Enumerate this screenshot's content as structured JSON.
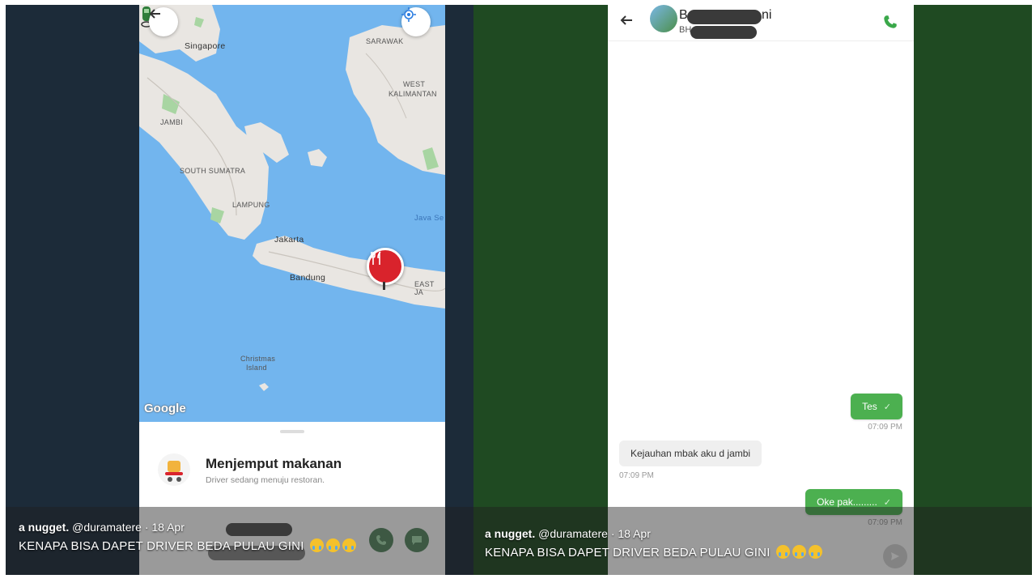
{
  "left": {
    "map": {
      "labels": {
        "singapore": "Singapore",
        "jambi": "JAMBI",
        "south_sumatra": "SOUTH SUMATRA",
        "lampung": "LAMPUNG",
        "jakarta": "Jakarta",
        "bandung": "Bandung",
        "west_kalimantan_1": "WEST",
        "west_kalimantan_2": "KALIMANTAN",
        "sarawak": "SARAWAK",
        "java_sea": "Java Se",
        "east_java": "EAST JA",
        "christmas_1": "Christmas",
        "christmas_2": "Island"
      },
      "google_logo": "Google"
    },
    "status_card": {
      "title": "Menjemput makanan",
      "subtitle": "Driver sedang menuju restoran."
    }
  },
  "right": {
    "chat": {
      "contact_name_start": "B",
      "contact_name_end": "ni",
      "contact_sub_start": "BH",
      "messages": [
        {
          "direction": "out",
          "text": "Tes",
          "time": "07:09 PM"
        },
        {
          "direction": "in",
          "text": "Kejauhan mbak aku d jambi",
          "time": "07:09 PM"
        },
        {
          "direction": "out",
          "text": "Oke pak.........",
          "time": "07:09 PM"
        }
      ]
    }
  },
  "caption": {
    "display_name": "a nugget.",
    "handle": "@duramatere",
    "separator": "·",
    "date": "18 Apr",
    "text": "KENAPA BISA DAPET DRIVER BEDA PULAU GINI"
  },
  "colors": {
    "left_background": "#1c2b39",
    "right_background": "#1f4a22",
    "sea": "#72b5ee",
    "land": "#e9e6e2",
    "pin_red": "#d9232c",
    "bubble_green": "#4cb050",
    "call_green": "#3aa84a"
  },
  "icons": {
    "back": "arrow-left-icon",
    "locate": "crosshair-icon",
    "restaurant": "fork-knife-icon",
    "call": "phone-icon",
    "read_receipt": "check-icon"
  }
}
